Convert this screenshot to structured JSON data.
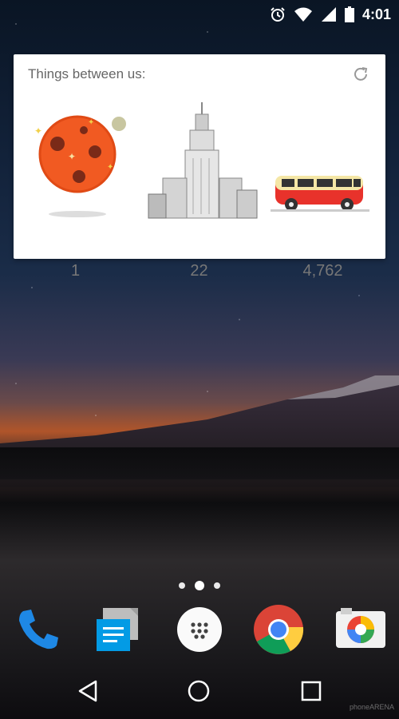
{
  "status_bar": {
    "time": "4:01",
    "icons": [
      "alarm-icon",
      "wifi-icon",
      "cell-signal-icon",
      "battery-icon"
    ]
  },
  "widget": {
    "title": "Things between us:",
    "refresh_icon": "refresh-icon",
    "items": [
      {
        "icon": "planet-icon",
        "value": "1"
      },
      {
        "icon": "skyscraper-icon",
        "value": "22"
      },
      {
        "icon": "bus-icon",
        "value": "4,762"
      }
    ]
  },
  "home": {
    "page_count": 3,
    "active_page": 2
  },
  "dock": {
    "apps": [
      "phone-icon",
      "messenger-icon",
      "app-drawer-icon",
      "chrome-icon",
      "camera-icon"
    ]
  },
  "navbar": {
    "buttons": [
      "back-icon",
      "home-icon",
      "recents-icon"
    ]
  },
  "watermark": "phoneARENA"
}
